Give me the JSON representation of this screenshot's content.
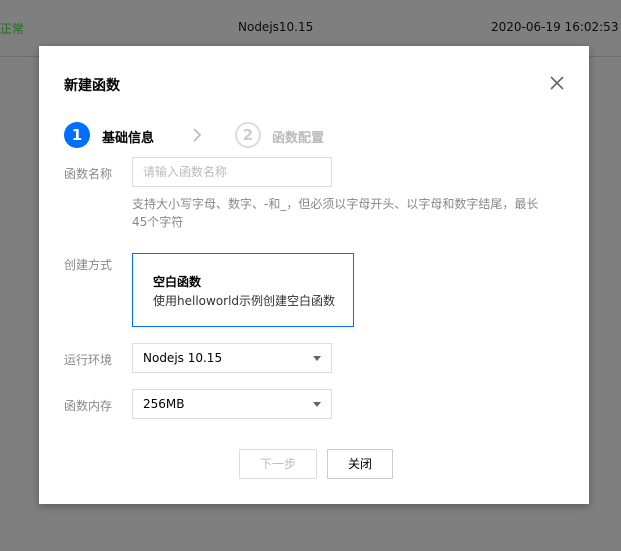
{
  "background": {
    "status": "正常",
    "runtime": "Nodejs10.15",
    "time": "2020-06-19 16:02:53"
  },
  "modal": {
    "title": "新建函数",
    "close_icon": "close-icon",
    "steps": [
      {
        "number": "1",
        "label": "基础信息",
        "active": true
      },
      {
        "number": "2",
        "label": "函数配置",
        "active": false
      }
    ],
    "step_arrow_icon": "chevron-right-icon",
    "fields": {
      "name": {
        "label": "函数名称",
        "placeholder": "请输入函数名称",
        "value": "",
        "hint": "支持大小写字母、数字、-和_，但必须以字母开头、以字母和数字结尾，最长45个字符"
      },
      "create_method": {
        "label": "创建方式",
        "option_title": "空白函数",
        "option_desc": "使用helloworld示例创建空白函数"
      },
      "runtime": {
        "label": "运行环境",
        "value": "Nodejs 10.15"
      },
      "memory": {
        "label": "函数内存",
        "value": "256MB"
      }
    },
    "buttons": {
      "next": "下一步",
      "close": "关闭"
    }
  },
  "colors": {
    "primary": "#006eff",
    "status_green": "#1c6f1a",
    "overlay": "#7f7f7f"
  }
}
